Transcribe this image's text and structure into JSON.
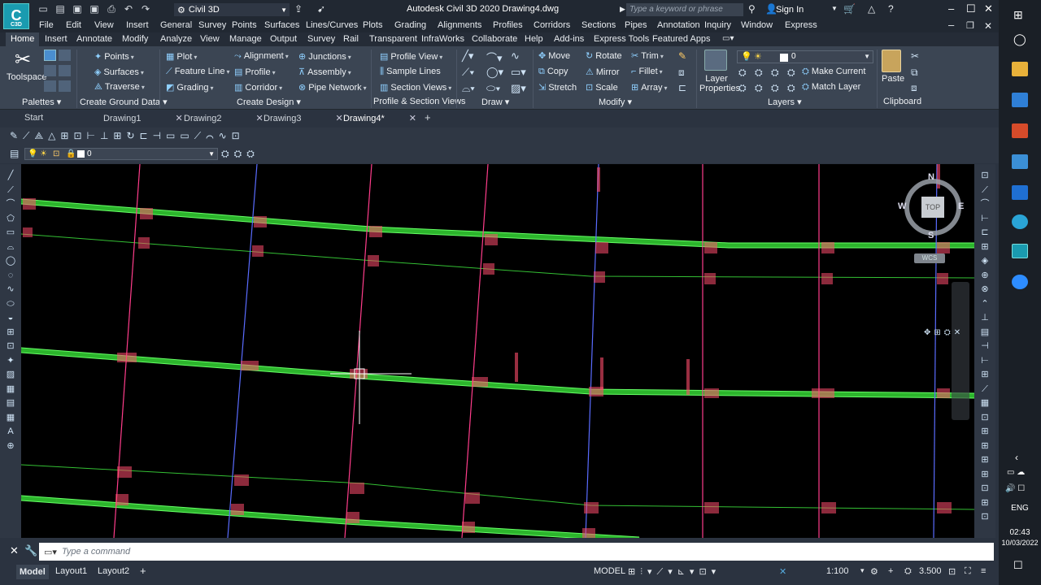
{
  "app": {
    "title": "Autodesk Civil 3D 2020  Drawing4.dwg",
    "logo_text": "C",
    "logo_sub": "C3D",
    "workspace": "Civil 3D",
    "search_placeholder": "Type a keyword or phrase",
    "sign_in": "Sign In"
  },
  "menubar": [
    "File",
    "Edit",
    "View",
    "Insert",
    "General",
    "Survey",
    "Points",
    "Surfaces",
    "Lines/Curves",
    "Plots",
    "Grading",
    "Alignments",
    "Profiles",
    "Corridors",
    "Sections",
    "Pipes",
    "Annotation",
    "Inquiry",
    "Window",
    "Express"
  ],
  "ribbon_tabs": [
    "Home",
    "Insert",
    "Annotate",
    "Modify",
    "Analyze",
    "View",
    "Manage",
    "Output",
    "Survey",
    "Rail",
    "Transparent",
    "InfraWorks",
    "Collaborate",
    "Help",
    "Add-ins",
    "Express Tools",
    "Featured Apps"
  ],
  "ribbon": {
    "toolspace": "Toolspace",
    "palettes": "Palettes",
    "ground": [
      "Points",
      "Surfaces",
      "Traverse"
    ],
    "ground_panel": "Create Ground Data",
    "design": [
      "Plot",
      "Feature Line",
      "Grading",
      "Alignment",
      "Profile",
      "Corridor",
      "Junctions",
      "Assembly",
      "Pipe Network"
    ],
    "design_panel": "Create Design",
    "profile": [
      "Profile View",
      "Sample Lines",
      "Section Views"
    ],
    "profile_panel": "Profile & Section Views",
    "draw_panel": "Draw",
    "modify": [
      "Move",
      "Copy",
      "Stretch",
      "Rotate",
      "Mirror",
      "Scale",
      "Trim",
      "Fillet",
      "Array"
    ],
    "modify_panel": "Modify",
    "layer_props": "Layer Properties",
    "layer_combo": "0",
    "make_current": "Make Current",
    "match_layer": "Match Layer",
    "layers_panel": "Layers",
    "paste": "Paste",
    "clipboard_panel": "Clipboard"
  },
  "doc_tabs": [
    "Start",
    "Drawing1",
    "Drawing2",
    "Drawing3",
    "Drawing4*"
  ],
  "layer_current": "0",
  "viewcube": {
    "n": "N",
    "s": "S",
    "e": "E",
    "w": "W",
    "top": "TOP",
    "wcs": "WCS"
  },
  "command_placeholder": "Type a command",
  "layout_tabs": [
    "Model",
    "Layout1",
    "Layout2"
  ],
  "status": {
    "model": "MODEL",
    "scale": "1:100",
    "lineweight": "3.500"
  },
  "system": {
    "lang": "ENG",
    "time": "02:43",
    "date": "10/03/2022"
  }
}
